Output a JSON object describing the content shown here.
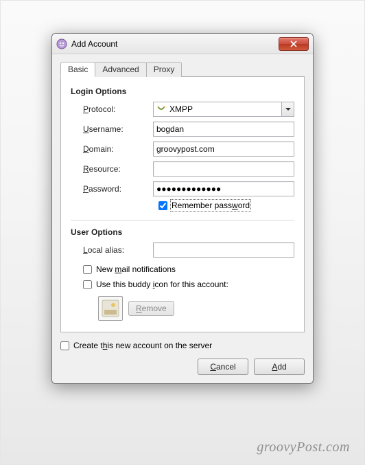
{
  "window": {
    "title": "Add Account"
  },
  "tabs": [
    "Basic",
    "Advanced",
    "Proxy"
  ],
  "login": {
    "section_title": "Login Options",
    "protocol_label": "Protocol:",
    "protocol_value": "XMPP",
    "username_label": "Username:",
    "username_value": "bogdan",
    "domain_label": "Domain:",
    "domain_value": "groovypost.com",
    "resource_label": "Resource:",
    "resource_value": "",
    "password_label": "Password:",
    "password_value": "●●●●●●●●●●●●●",
    "remember_label": "Remember password",
    "remember_checked": true
  },
  "user": {
    "section_title": "User Options",
    "local_alias_label": "Local alias:",
    "local_alias_value": "",
    "new_mail_label": "New mail notifications",
    "buddy_icon_label": "Use this buddy icon for this account:",
    "remove_label": "Remove"
  },
  "create_account_label": "Create this new account on the server",
  "buttons": {
    "cancel": "Cancel",
    "add": "Add"
  },
  "watermark": "groovyPost.com"
}
